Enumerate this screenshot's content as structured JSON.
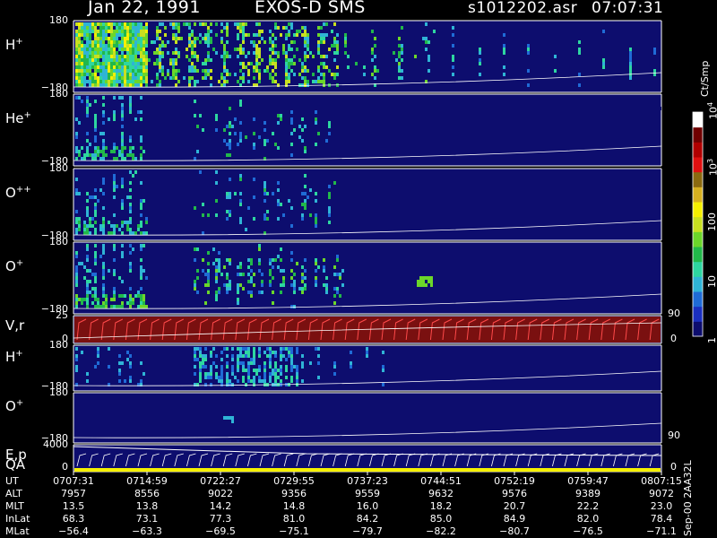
{
  "header": {
    "date": "Jan 22, 1991",
    "mission": "EXOS-D SMS",
    "file": "s1012202.asr",
    "time": "07:07:31"
  },
  "colorbar": {
    "unit": "Ct/Smp",
    "ticks": [
      {
        "label": "1",
        "value": 1
      },
      {
        "label": "10",
        "value": 10
      },
      {
        "label": "100",
        "value": 100
      },
      {
        "label": "10",
        "sup": "3",
        "value": 1000
      },
      {
        "label": "10",
        "sup": "4",
        "value": 10000
      }
    ],
    "colors": [
      "#0d0d6e",
      "#1a2fc0",
      "#1f6bd6",
      "#2fb4d6",
      "#2ed6a0",
      "#22b84a",
      "#6cd62a",
      "#c8e020",
      "#f5f000",
      "#d6b020",
      "#8b6a10",
      "#e01010",
      "#b00000",
      "#700000",
      "#ffffff"
    ]
  },
  "panels": [
    {
      "id": "h1",
      "label": "H",
      "sup": "+",
      "top_tick": "180",
      "bottom_tick": "−180",
      "intensity": "high"
    },
    {
      "id": "he",
      "label": "He",
      "sup": "+",
      "top_tick": "180",
      "bottom_tick": "−180",
      "intensity": "low"
    },
    {
      "id": "opp",
      "label": "O",
      "sup": "++",
      "top_tick": "180",
      "bottom_tick": "−180",
      "intensity": "low"
    },
    {
      "id": "o1",
      "label": "O",
      "sup": "+",
      "top_tick": "180",
      "bottom_tick": "−180",
      "intensity": "mid"
    },
    {
      "id": "vr",
      "label": "V,r",
      "sup": "",
      "top_tick": "25",
      "bottom_tick": "0",
      "right_top": "90",
      "right_bottom": "0"
    },
    {
      "id": "h2",
      "label": "H",
      "sup": "+",
      "top_tick": "180",
      "bottom_tick": "−180",
      "intensity": "band"
    },
    {
      "id": "o2",
      "label": "O",
      "sup": "+",
      "top_tick": "180",
      "bottom_tick": "−180",
      "intensity": "none"
    },
    {
      "id": "ep",
      "label": "E,p",
      "sup": "",
      "top_tick": "4000",
      "bottom_tick": "0",
      "right_top": "90",
      "right_bottom": "0",
      "label2": "QA"
    }
  ],
  "chart_data": {
    "type": "heatmap",
    "title": "Jan 22, 1991   EXOS-D SMS",
    "xlabel": "UT",
    "x_ticks": [
      "0707:31",
      "0714:59",
      "0722:27",
      "0729:55",
      "0737:23",
      "0744:51",
      "0752:19",
      "0759:47",
      "0807:15"
    ],
    "ephemeris": [
      {
        "name": "UT",
        "values": [
          "0707:31",
          "0714:59",
          "0722:27",
          "0729:55",
          "0737:23",
          "0744:51",
          "0752:19",
          "0759:47",
          "0807:15"
        ]
      },
      {
        "name": "ALT",
        "values": [
          "7957",
          "8556",
          "9022",
          "9356",
          "9559",
          "9632",
          "9576",
          "9389",
          "9072"
        ]
      },
      {
        "name": "MLT",
        "values": [
          "13.5",
          "13.8",
          "14.2",
          "14.8",
          "16.0",
          "18.2",
          "20.7",
          "22.2",
          "23.0"
        ]
      },
      {
        "name": "InLat",
        "values": [
          "68.3",
          "73.1",
          "77.3",
          "81.0",
          "84.2",
          "85.0",
          "84.9",
          "82.0",
          "78.4"
        ]
      },
      {
        "name": "MLat",
        "values": [
          "−56.4",
          "−63.3",
          "−69.5",
          "−75.1",
          "−79.7",
          "−82.2",
          "−80.7",
          "−76.5",
          "−71.1"
        ]
      }
    ],
    "side_note": "Sep-00  2AA32L"
  }
}
